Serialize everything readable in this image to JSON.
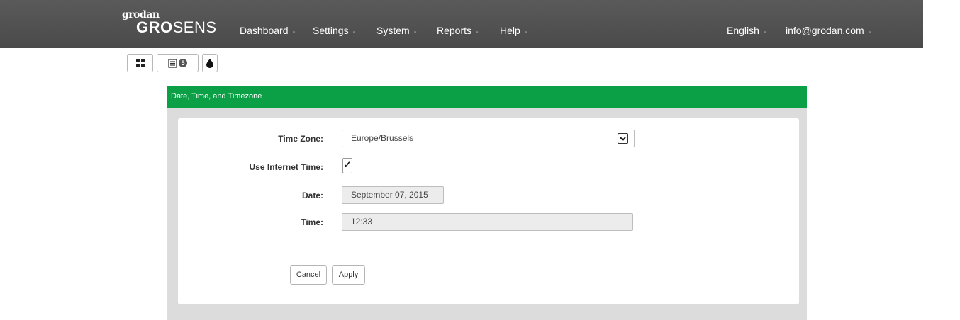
{
  "brand": {
    "small": "grodan",
    "gro": "GRO",
    "sens": "SENS"
  },
  "nav": {
    "items": [
      {
        "label": "Dashboard",
        "caret": "-"
      },
      {
        "label": "Settings",
        "caret": "-"
      },
      {
        "label": "System",
        "caret": "-"
      },
      {
        "label": "Reports",
        "caret": "-"
      },
      {
        "label": "Help",
        "caret": "-"
      }
    ],
    "language": {
      "label": "English",
      "caret": "-"
    },
    "account": {
      "label": "info@grodan.com",
      "caret": "-"
    }
  },
  "toolbar": {
    "grid_icon": "grid-icon",
    "list_icon": "list-icon",
    "list_badge": "5",
    "drop_icon": "water-drop-icon"
  },
  "panel": {
    "title": "Date, Time, and Timezone",
    "header_color": "#0ca046",
    "timezone": {
      "label": "Time Zone:",
      "value": "Europe/Brussels"
    },
    "internet_time": {
      "label": "Use Internet Time:",
      "checked": true,
      "mark": "✓"
    },
    "date": {
      "label": "Date:",
      "value": "September 07, 2015"
    },
    "time": {
      "label": "Time:",
      "value": "12:33"
    },
    "buttons": {
      "cancel": "Cancel",
      "apply": "Apply"
    }
  }
}
